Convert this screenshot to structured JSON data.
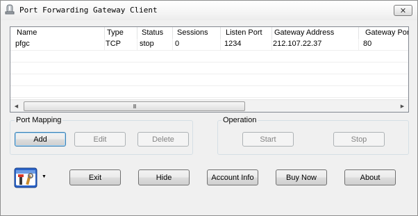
{
  "window": {
    "title": "Port Forwarding Gateway Client",
    "close_glyph": "✕",
    "app_icon": "bell-icon"
  },
  "list": {
    "columns": [
      "Name",
      "Type",
      "Status",
      "Sessions",
      "Listen Port",
      "Gateway Address",
      "Gateway Por"
    ],
    "rows": [
      [
        "pfgc",
        "TCP",
        "stop",
        "0",
        "1234",
        "212.107.22.37",
        "80"
      ]
    ],
    "scrollbar": {
      "left_arrow": "◀",
      "right_arrow": "▶",
      "thumb_grip": "III"
    }
  },
  "port_mapping": {
    "label": "Port Mapping",
    "add": "Add",
    "edit": "Edit",
    "delete": "Delete"
  },
  "operation": {
    "label": "Operation",
    "start": "Start",
    "stop": "Stop"
  },
  "bottom": {
    "tools_icon": "tools-icon",
    "dropdown_glyph": "▼",
    "exit": "Exit",
    "hide": "Hide",
    "account_info": "Account Info",
    "buy_now": "Buy Now",
    "about": "About"
  }
}
